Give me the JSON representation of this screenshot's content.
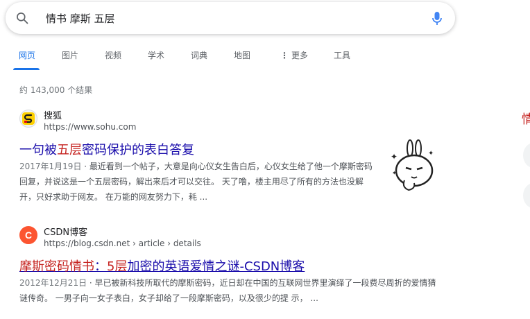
{
  "search": {
    "query": "情书 摩斯 五层"
  },
  "tabs": [
    {
      "label": "网页",
      "active": true
    },
    {
      "label": "图片"
    },
    {
      "label": "视频"
    },
    {
      "label": "学术"
    },
    {
      "label": "词典"
    },
    {
      "label": "地图"
    },
    {
      "label": "更多"
    },
    {
      "label": "工具"
    }
  ],
  "stats": "约 143,000 个结果",
  "results": [
    {
      "site_name": "搜狐",
      "url": "https://www.sohu.com",
      "title_parts": [
        "一句被",
        "五层",
        "密码保护的表白答复"
      ],
      "date": "2017年1月19日",
      "snippet": "最近看到一个帖子，大意是向心仪女生告白后，心仪女生给了他一个摩斯密码回复，并说这是一个五层密码，解出来后才可以交往。 天了噜，楼主用尽了所有的方法也没解开，只好求助于网友。 在万能的网友努力下，耗 ..."
    },
    {
      "site_name": "CSDN博客",
      "url": "https://blog.csdn.net › article › details",
      "title_parts": [
        "摩斯密码",
        "情书",
        "：",
        "5层",
        "加密的英语爱情之谜-CSDN博客"
      ],
      "date": "2012年12月21日",
      "snippet": "早已被新科技所取代的摩斯密码，近日却在中国的互联网世界里演绎了一段费尽周折的爱情猜谜传奇。 一男子向一女子表白，女子却给了一段摩斯密码，以及很少的提 示， ..."
    }
  ],
  "right_panel": {
    "partial_char": "情"
  },
  "colors": {
    "link": "#1a0dab",
    "highlight": "#c5221f",
    "accent": "#1a73e8"
  }
}
